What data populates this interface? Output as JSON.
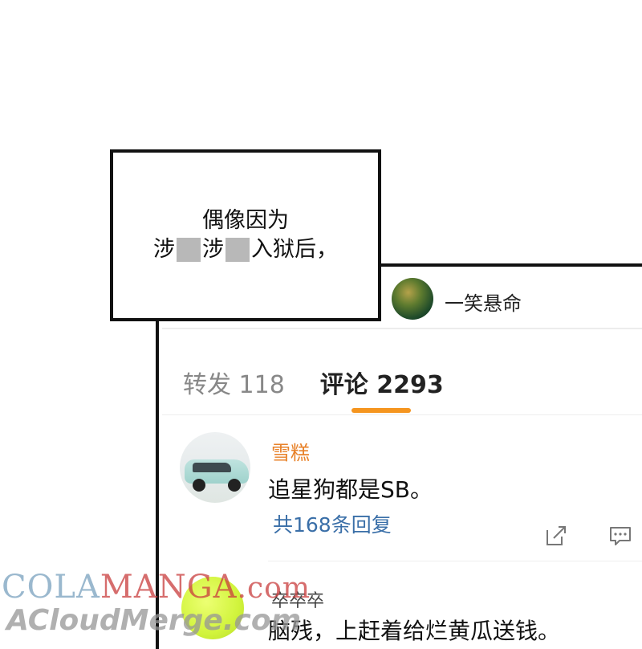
{
  "caption": {
    "line1": "偶像因为",
    "line2_part1": "涉",
    "line2_part2": "涉",
    "line2_part3": "入狱后，"
  },
  "post_header": {
    "username": "一笑悬命"
  },
  "tabs": [
    {
      "label": "转发 118",
      "active": false
    },
    {
      "label": "评论 2293",
      "active": true
    }
  ],
  "comments": [
    {
      "username": "雪糕",
      "text": "追星狗都是SB。",
      "reply_count": "共168条回复",
      "actions": [
        "share-icon",
        "comment-icon"
      ]
    },
    {
      "username": "卒卒卒",
      "text": "脑残，上赶着给烂黄瓜送钱。"
    }
  ],
  "watermark": {
    "line1_a": "COLA",
    "line1_b": "MANGA",
    "line1_c": ".com",
    "line2": "ACloudMerge.com"
  },
  "colors": {
    "accent_orange": "#f5951f",
    "username_orange": "#e8822a",
    "link_blue": "#3a6fa8",
    "censor_gray": "#b8b8b8"
  }
}
